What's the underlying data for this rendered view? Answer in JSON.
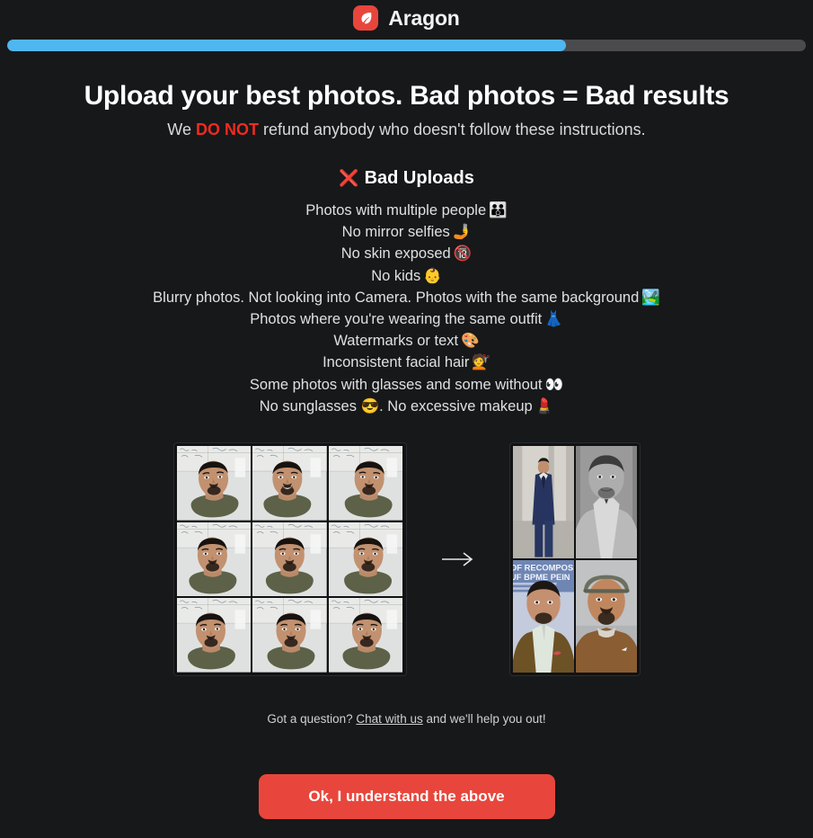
{
  "brand": {
    "name": "Aragon",
    "logo_icon": "leaf-icon",
    "logo_color": "#e8463c"
  },
  "progress": {
    "percent": 70,
    "fill_color": "#4fb7f0",
    "track_color": "#4b4b4d"
  },
  "header": {
    "headline": "Upload your best photos. Bad photos = Bad results",
    "subhead_before": "We ",
    "subhead_emphasis": "DO NOT",
    "subhead_after": " refund anybody who doesn't follow these instructions.",
    "emphasis_color": "#ef2b20"
  },
  "bad_uploads": {
    "icon": "❌",
    "title": "Bad Uploads",
    "rules": [
      {
        "text": "Photos with multiple people",
        "emoji": "👪"
      },
      {
        "text": "No mirror selfies",
        "emoji": "🤳"
      },
      {
        "text": "No skin exposed",
        "emoji": "🔞"
      },
      {
        "text": "No kids",
        "emoji": "👶"
      },
      {
        "text": "Blurry photos. Not looking into Camera. Photos with the same background",
        "emoji": "🏞️"
      },
      {
        "text": "Photos where you're wearing the same outfit",
        "emoji": "👗"
      },
      {
        "text": "Watermarks or text",
        "emoji": "🎨"
      },
      {
        "text": "Inconsistent facial hair",
        "emoji": "💇"
      },
      {
        "text": "Some photos with glasses and some without",
        "emoji": "👀"
      },
      {
        "text": "No sunglasses 😎. No excessive makeup",
        "emoji": "💄"
      }
    ]
  },
  "examples": {
    "input_label": "uploaded selfie grid",
    "output_label": "generated headshot grid",
    "arrow_icon": "arrow-right-icon",
    "generated_overlay_text_line1": "OFOF RECOMPOS",
    "generated_overlay_text_line2": "RSUF BPME PEIN"
  },
  "footer": {
    "help_before": "Got a question? ",
    "help_link": "Chat with us",
    "help_after": " and we'll help you out!",
    "cta_label": "Ok, I understand the above",
    "cta_color": "#e8463c"
  }
}
